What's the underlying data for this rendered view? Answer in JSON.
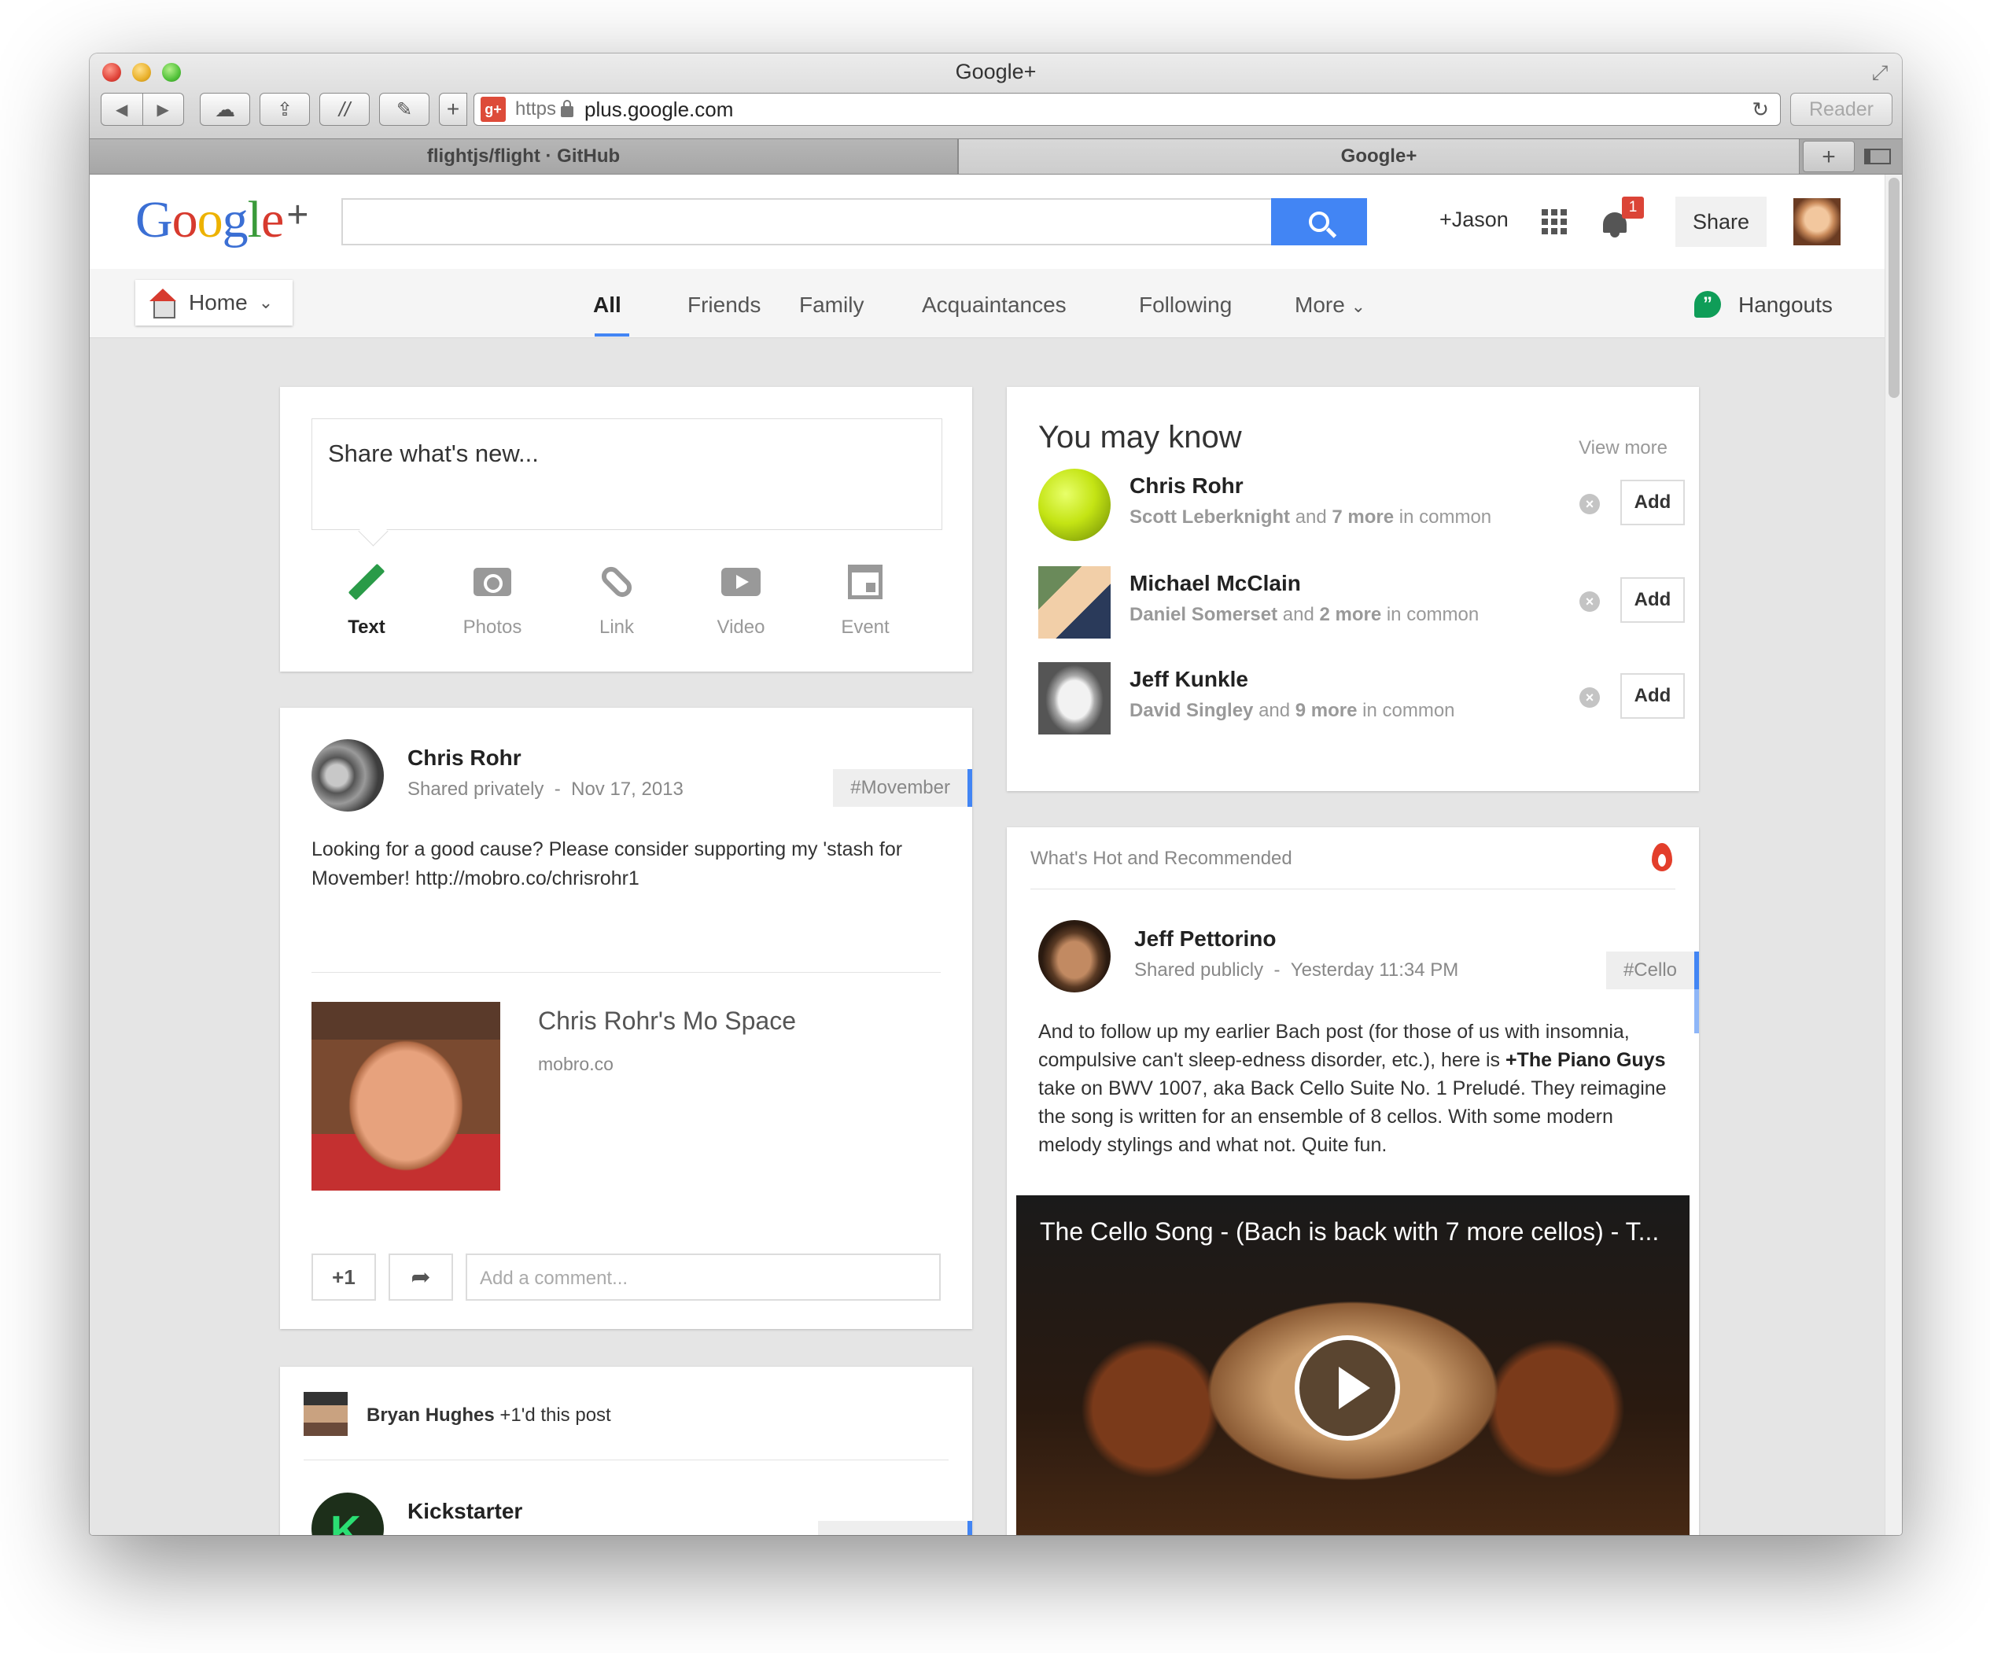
{
  "browser": {
    "window_title": "Google+",
    "url_scheme": "https",
    "url_domain": "plus.google.com",
    "reader_label": "Reader",
    "tabs": [
      {
        "label": "flightjs/flight · GitHub",
        "active": false
      },
      {
        "label": "Google+",
        "active": true
      }
    ]
  },
  "header": {
    "logo_g1": "G",
    "logo_o1": "o",
    "logo_o2": "o",
    "logo_g2": "g",
    "logo_l": "l",
    "logo_e": "e",
    "logo_plus": "+",
    "search_placeholder": "",
    "profile_name": "+Jason",
    "notification_count": "1",
    "share_label": "Share"
  },
  "nav": {
    "home_label": "Home",
    "tabs": [
      "All",
      "Friends",
      "Family",
      "Acquaintances",
      "Following",
      "More"
    ],
    "active_tab": "All",
    "hangouts_label": "Hangouts"
  },
  "share_box": {
    "placeholder": "Share what's new...",
    "options": [
      "Text",
      "Photos",
      "Link",
      "Video",
      "Event"
    ]
  },
  "post1": {
    "author": "Chris Rohr",
    "visibility": "Shared privately",
    "date": "Nov 17, 2013",
    "tag": "#Movember",
    "text": "Looking for a good cause? Please consider supporting my 'stash for Movember! http://mobro.co/chrisrohr1",
    "link_title": "Chris Rohr's Mo Space",
    "link_domain": "mobro.co",
    "plus_one_label": "+1",
    "comment_placeholder": "Add a comment..."
  },
  "post2": {
    "plusoner": "Bryan Hughes",
    "plusoned_text": "+1'd this post",
    "author": "Kickstarter"
  },
  "you_may_know": {
    "title": "You may know",
    "view_more": "View more",
    "people": [
      {
        "name": "Chris Rohr",
        "mutual": "Scott Leberknight",
        "joiner": "and",
        "more": "7 more",
        "suffix": "in common",
        "add_label": "Add"
      },
      {
        "name": "Michael McClain",
        "mutual": "Daniel Somerset",
        "joiner": "and",
        "more": "2 more",
        "suffix": "in common",
        "add_label": "Add"
      },
      {
        "name": "Jeff Kunkle",
        "mutual": "David Singley",
        "joiner": "and",
        "more": "9 more",
        "suffix": "in common",
        "add_label": "Add"
      }
    ]
  },
  "whats_hot": {
    "title": "What's Hot and Recommended",
    "author": "Jeff Pettorino",
    "visibility": "Shared publicly",
    "date": "Yesterday 11:34 PM",
    "tag": "#Cello",
    "text_part1": "And to follow up my earlier Bach post (for those of us with insomnia, compulsive can't sleep-edness disorder, etc.), here is ",
    "text_bold": "+The Piano Guys",
    "text_part2": " take on BWV 1007, aka Back Cello Suite No. 1 Preludé. They reimagine the song is written for an ensemble of 8 cellos. With some modern melody stylings and what not. Quite fun.",
    "video_title": "The Cello Song - (Bach is back with 7 more cellos) - T..."
  },
  "colors": {
    "accent_blue": "#4285f4",
    "gplus_red": "#dd4b39",
    "hangouts_green": "#0f9d58",
    "notification_red": "#db4437"
  }
}
